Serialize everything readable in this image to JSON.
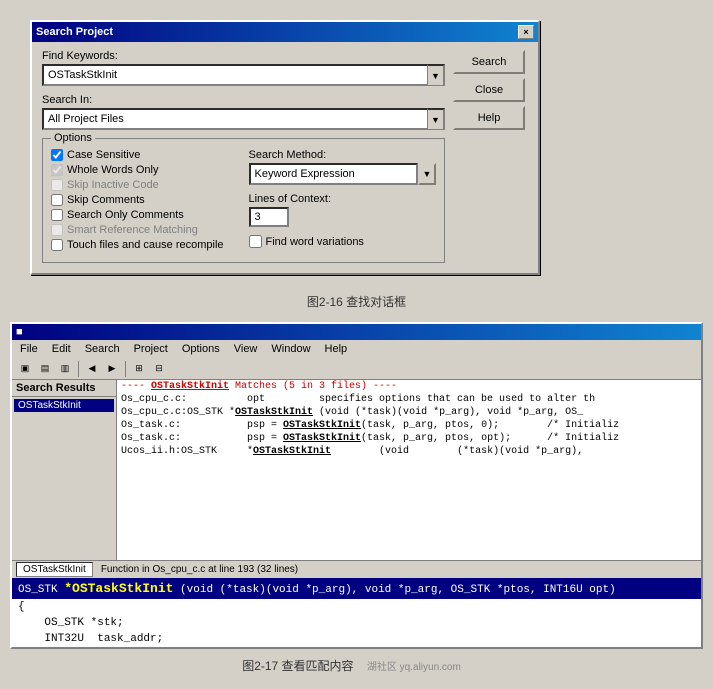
{
  "dialog": {
    "title": "Search Project",
    "close_btn": "×",
    "find_keywords_label": "Find Keywords:",
    "find_keywords_value": "OSTaskStkInit",
    "search_in_label": "Search In:",
    "search_in_value": "All Project Files",
    "options_group_label": "Options",
    "checkboxes": [
      {
        "label": "Case Sensitive",
        "checked": true,
        "disabled": false
      },
      {
        "label": "Whole Words Only",
        "checked": true,
        "disabled": true
      },
      {
        "label": "Skip Inactive Code",
        "checked": false,
        "disabled": true
      },
      {
        "label": "Skip Comments",
        "checked": false,
        "disabled": false
      },
      {
        "label": "Search Only Comments",
        "checked": false,
        "disabled": false
      },
      {
        "label": "Smart Reference Matching",
        "checked": false,
        "disabled": true
      },
      {
        "label": "Touch files and cause recompile",
        "checked": false,
        "disabled": false
      }
    ],
    "search_method_label": "Search Method:",
    "search_method_value": "Keyword Expression",
    "lines_of_context_label": "Lines of Context:",
    "lines_of_context_value": "3",
    "find_word_variations": {
      "checked": false,
      "label": "Find word variations"
    },
    "buttons": {
      "search": "Search",
      "close": "Close",
      "help": "Help"
    }
  },
  "caption1": "图2-16  查找对话框",
  "ide": {
    "menu_items": [
      "File",
      "Edit",
      "Search",
      "Project",
      "Options",
      "View",
      "Window",
      "Help"
    ],
    "results_title": "Search Results",
    "results_item": "OSTaskStkInit",
    "match_header": "---- OSTaskStkInit Matches (5 in 3 files) ----",
    "code_lines": [
      "Os_cpu_c.c:          opt         specifies options that can be used to alter th",
      "Os_cpu_c.c:OS_STK *OSTaskStkInit (void (*task)(void *p_arg), void *p_arg, OS_",
      "Os_task.c:           psp = OSTaskStkInit(task, p_arg, ptos, 0);        /* Initializ",
      "Os_task.c:           psp = OSTaskStkInit(task, p_arg, ptos, opt);      /* Initializ",
      "Ucos_ii.h:OS_STK     *OSTaskStkInit        (void        (*task)(void *p_arg),"
    ],
    "bottom_tab1": "OSTaskStkInit",
    "bottom_tab2": "Function in Os_cpu_c.c at line 193 (32 lines)",
    "bottom_code": "*OSTaskStkInit (void (*task)(void *p_arg), void *p_arg, OS_STK *ptos, INT16U opt)",
    "func_name": "*OSTaskStkInit",
    "source_lines": [
      "{",
      "    OS_STK *stk;",
      "    INT32U  task_addr;"
    ]
  },
  "caption2": "图2-17  查看匹配内容",
  "watermark": "湖社区 yq.aliyun.com"
}
